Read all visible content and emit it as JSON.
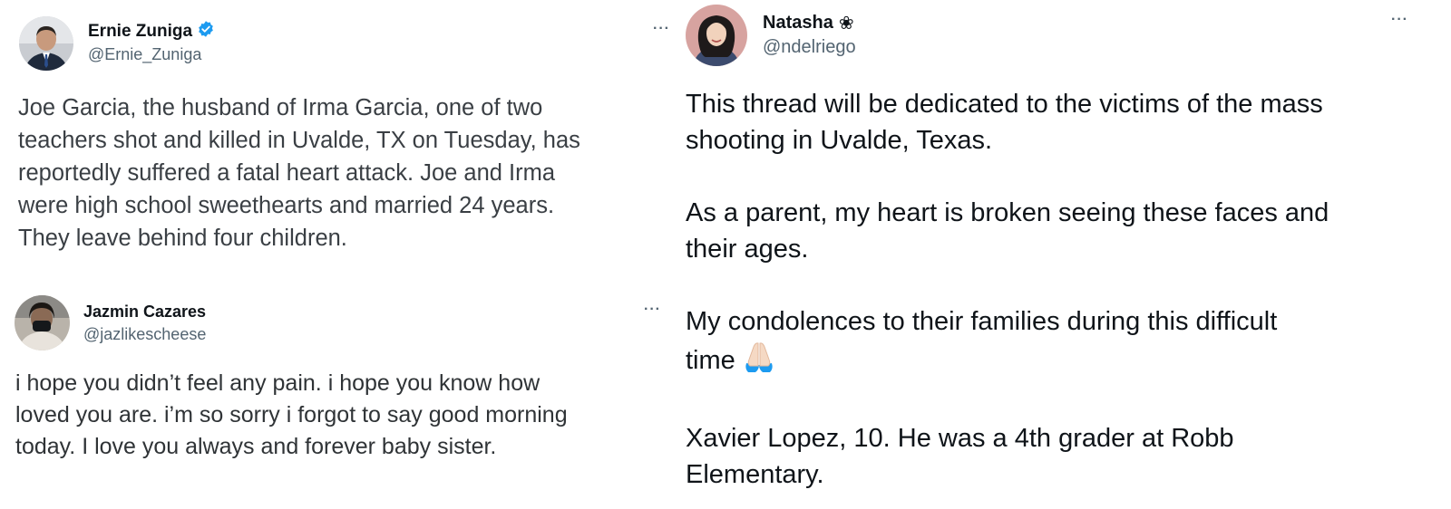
{
  "tweets": [
    {
      "display_name": "Ernie Zuniga",
      "handle": "@Ernie_Zuniga",
      "verified": true,
      "more_label": "···",
      "text": "Joe Garcia, the husband of Irma Garcia, one of two\nteachers shot and killed in Uvalde, TX on Tuesday, has\nreportedly suffered a fatal heart attack. Joe and Irma\nwere high school sweethearts and married 24 years.\nThey leave behind four children."
    },
    {
      "display_name": "Jazmin Cazares",
      "handle": "@jazlikescheese",
      "verified": false,
      "more_label": "···",
      "text": "i hope you didn’t feel any pain. i hope you know how\nloved you are. i’m so sorry i forgot to say good morning\ntoday. I love you always and forever baby sister."
    },
    {
      "display_name": "Natasha",
      "name_symbol": "❀",
      "handle": "@ndelriego",
      "verified": false,
      "more_label": "···",
      "text_p1": "This thread will be dedicated to the victims of the mass\nshooting in Uvalde, Texas.\n\nAs a parent, my heart is broken seeing these faces and\ntheir ages.\n\nMy condolences to their families during this difficult\ntime",
      "text_p2": "\n\nXavier Lopez, 10. He was a 4th grader at Robb\nElementary."
    }
  ],
  "colors": {
    "text_primary": "#0f1419",
    "text_secondary": "#536471",
    "verified_blue": "#1d9bf0"
  },
  "icons": {
    "verified": "verified-badge-icon",
    "more": "more-options-icon",
    "pray": "folded-hands-emoji-icon"
  }
}
